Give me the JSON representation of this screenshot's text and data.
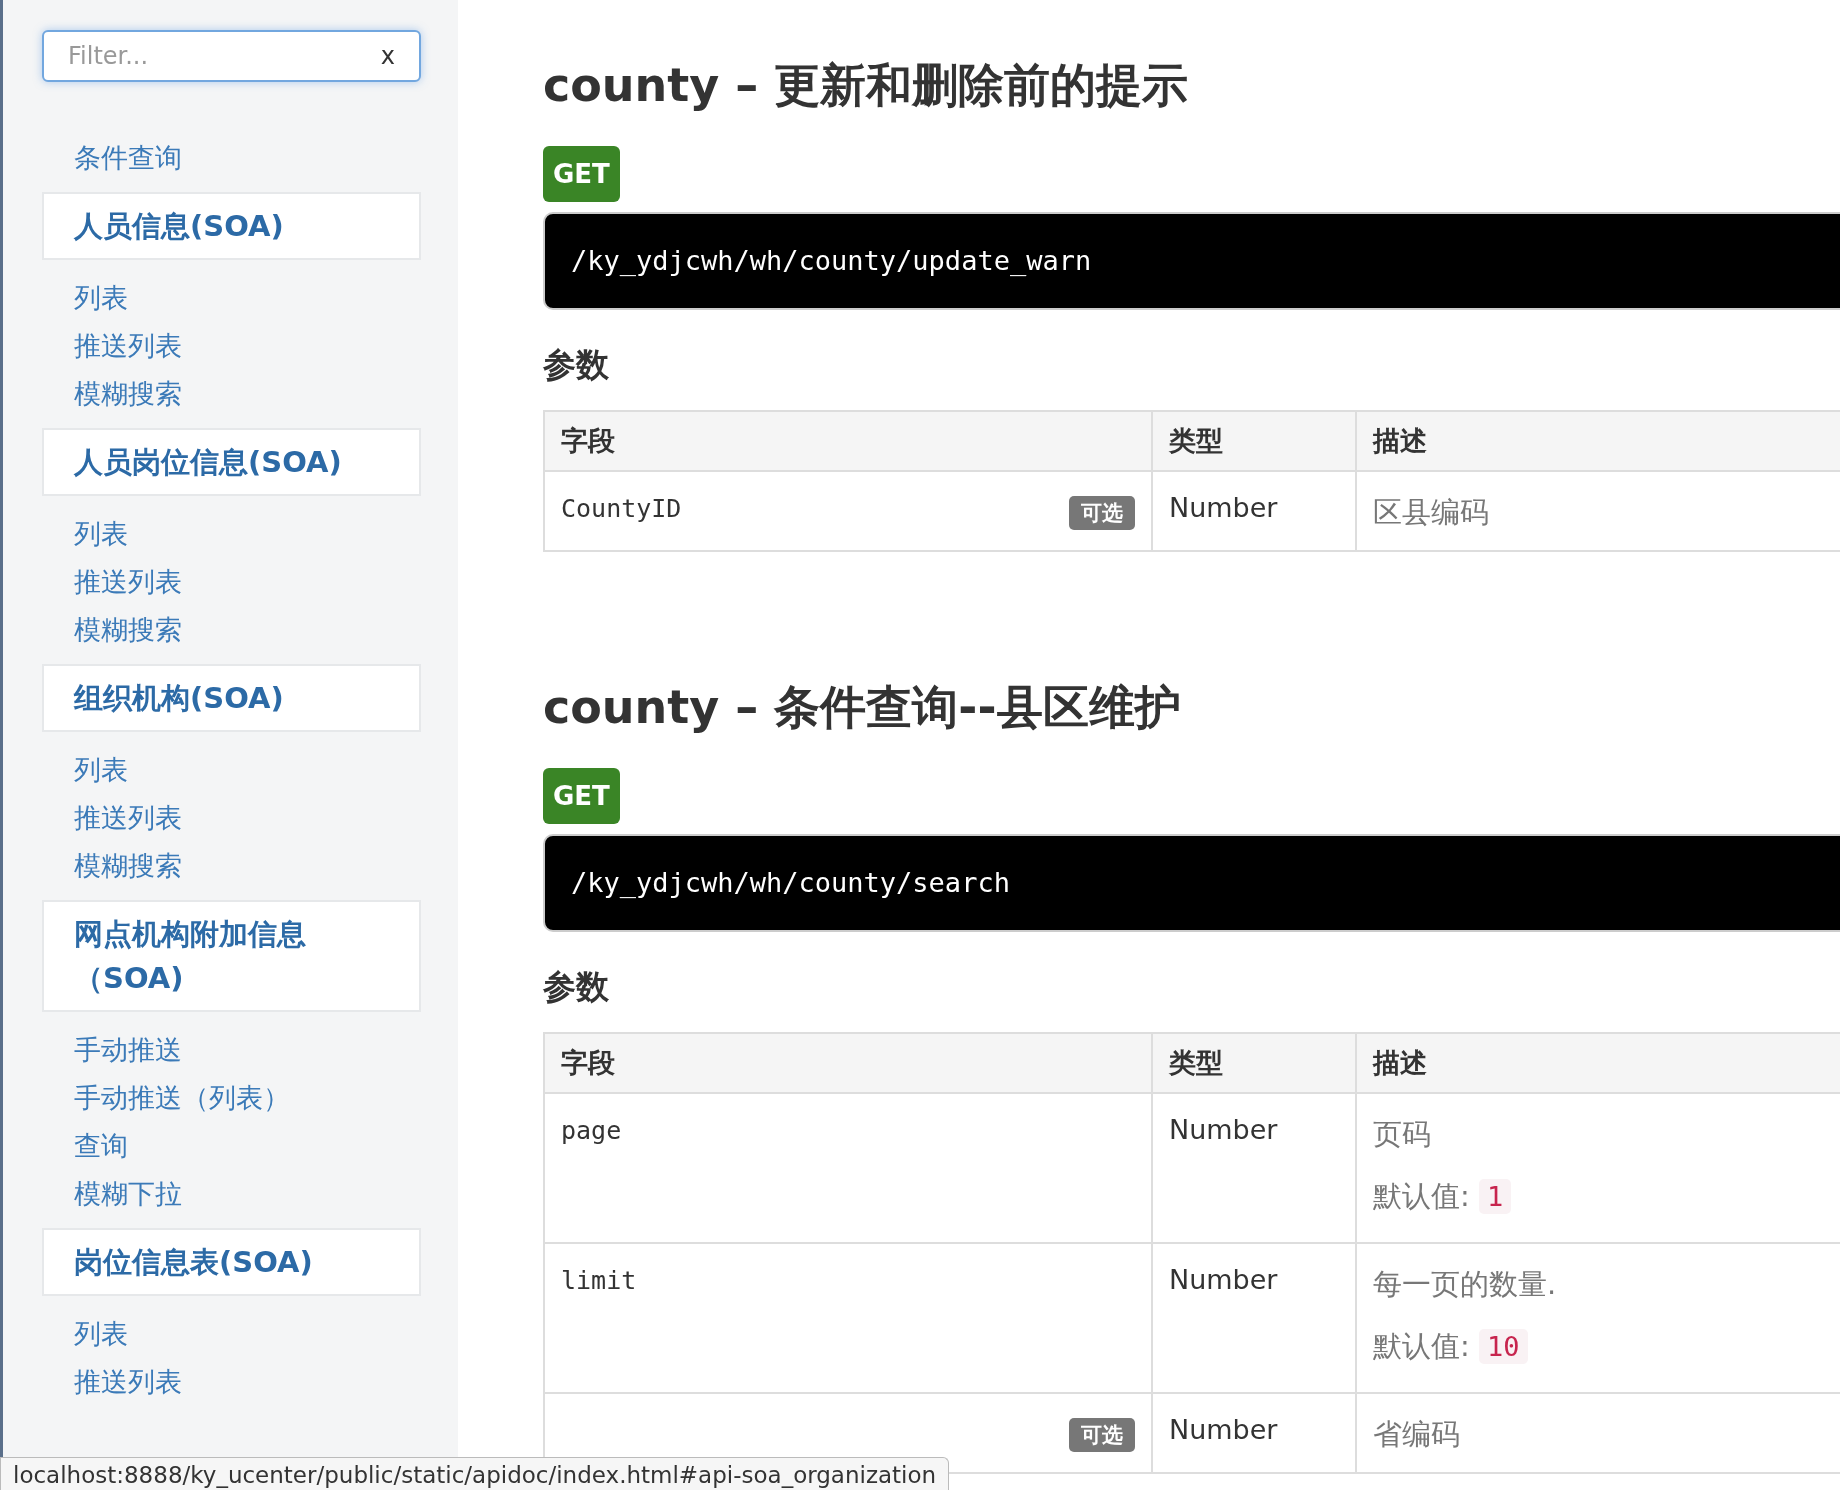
{
  "sidebar": {
    "filter": {
      "placeholder": "Filter...",
      "clear": "x"
    },
    "groups": [
      {
        "items": [
          "条件查询"
        ]
      },
      {
        "title": "人员信息(SOA)",
        "items": [
          "列表",
          "推送列表",
          "模糊搜索"
        ]
      },
      {
        "title": "人员岗位信息(SOA)",
        "items": [
          "列表",
          "推送列表",
          "模糊搜索"
        ]
      },
      {
        "title": "组织机构(SOA)",
        "items": [
          "列表",
          "推送列表",
          "模糊搜索"
        ]
      },
      {
        "title": "网点机构附加信息（SOA)",
        "items": [
          "手动推送",
          "手动推送（列表）",
          "查询",
          "模糊下拉"
        ]
      },
      {
        "title": "岗位信息表(SOA)",
        "items": [
          "列表",
          "推送列表"
        ]
      }
    ]
  },
  "sections": [
    {
      "title": "county – 更新和删除前的提示",
      "method": "GET",
      "path": "/ky_ydjcwh/wh/county/update_warn",
      "params_title": "参数",
      "columns": [
        "字段",
        "类型",
        "描述"
      ],
      "rows": [
        {
          "field": "CountyID",
          "optional": "可选",
          "type": "Number",
          "description": "区县编码"
        }
      ]
    },
    {
      "title": "county – 条件查询--县区维护",
      "method": "GET",
      "path": "/ky_ydjcwh/wh/county/search",
      "params_title": "参数",
      "columns": [
        "字段",
        "类型",
        "描述"
      ],
      "rows": [
        {
          "field": "page",
          "type": "Number",
          "description": "页码",
          "default_label": "默认值:",
          "default_value": "1"
        },
        {
          "field": "limit",
          "type": "Number",
          "description": "每一页的数量.",
          "default_label": "默认值:",
          "default_value": "10"
        },
        {
          "optional": "可选",
          "type": "Number",
          "description": "省编码"
        }
      ]
    }
  ],
  "status_bar": "localhost:8888/ky_ucenter/public/static/apidoc/index.html#api-soa_organization"
}
